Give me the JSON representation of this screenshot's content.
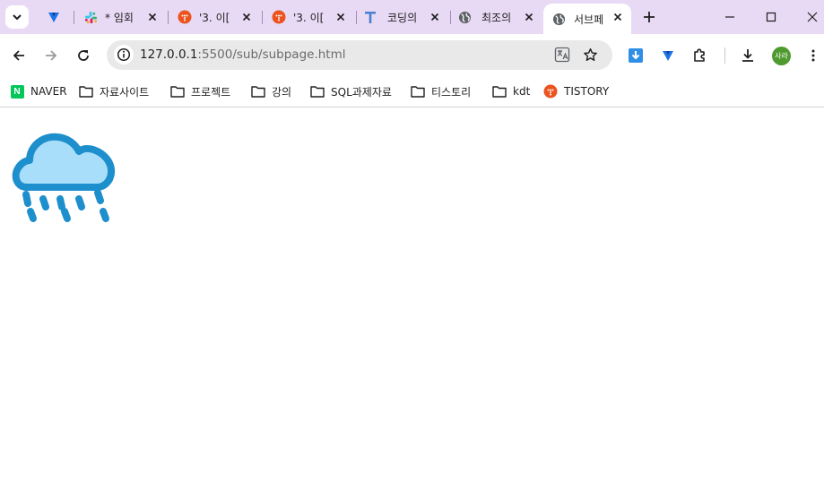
{
  "tabs": [
    {
      "title": "",
      "icon": "vertical-v-icon"
    },
    {
      "title": "* 임회",
      "icon": "slack-icon"
    },
    {
      "title": "'3. 이[",
      "icon": "tistory-icon"
    },
    {
      "title": "'3. 이[",
      "icon": "tistory-icon"
    },
    {
      "title": "코딩의",
      "icon": "typora-t-icon"
    },
    {
      "title": "최조의",
      "icon": "globe-icon"
    },
    {
      "title": "서브페",
      "icon": "globe-icon",
      "active": true
    }
  ],
  "toolbar": {
    "url_host": "127.0.0.1",
    "url_path": ":5500/sub/subpage.html",
    "profile_initials": "사라"
  },
  "bookmarks": [
    {
      "label": "NAVER",
      "icon": "naver-icon"
    },
    {
      "label": "자료사이트",
      "icon": "folder-icon"
    },
    {
      "label": "프로젝트",
      "icon": "folder-icon"
    },
    {
      "label": "강의",
      "icon": "folder-icon"
    },
    {
      "label": "SQL과제자료",
      "icon": "folder-icon"
    },
    {
      "label": "티스토리",
      "icon": "folder-icon"
    },
    {
      "label": "kdt",
      "icon": "folder-icon"
    },
    {
      "label": "TISTORY",
      "icon": "tistory-icon"
    }
  ],
  "page": {
    "icon": "rain-cloud-icon",
    "colors": {
      "cloud_fill": "#a9defa",
      "cloud_stroke": "#1d8fcc"
    }
  }
}
